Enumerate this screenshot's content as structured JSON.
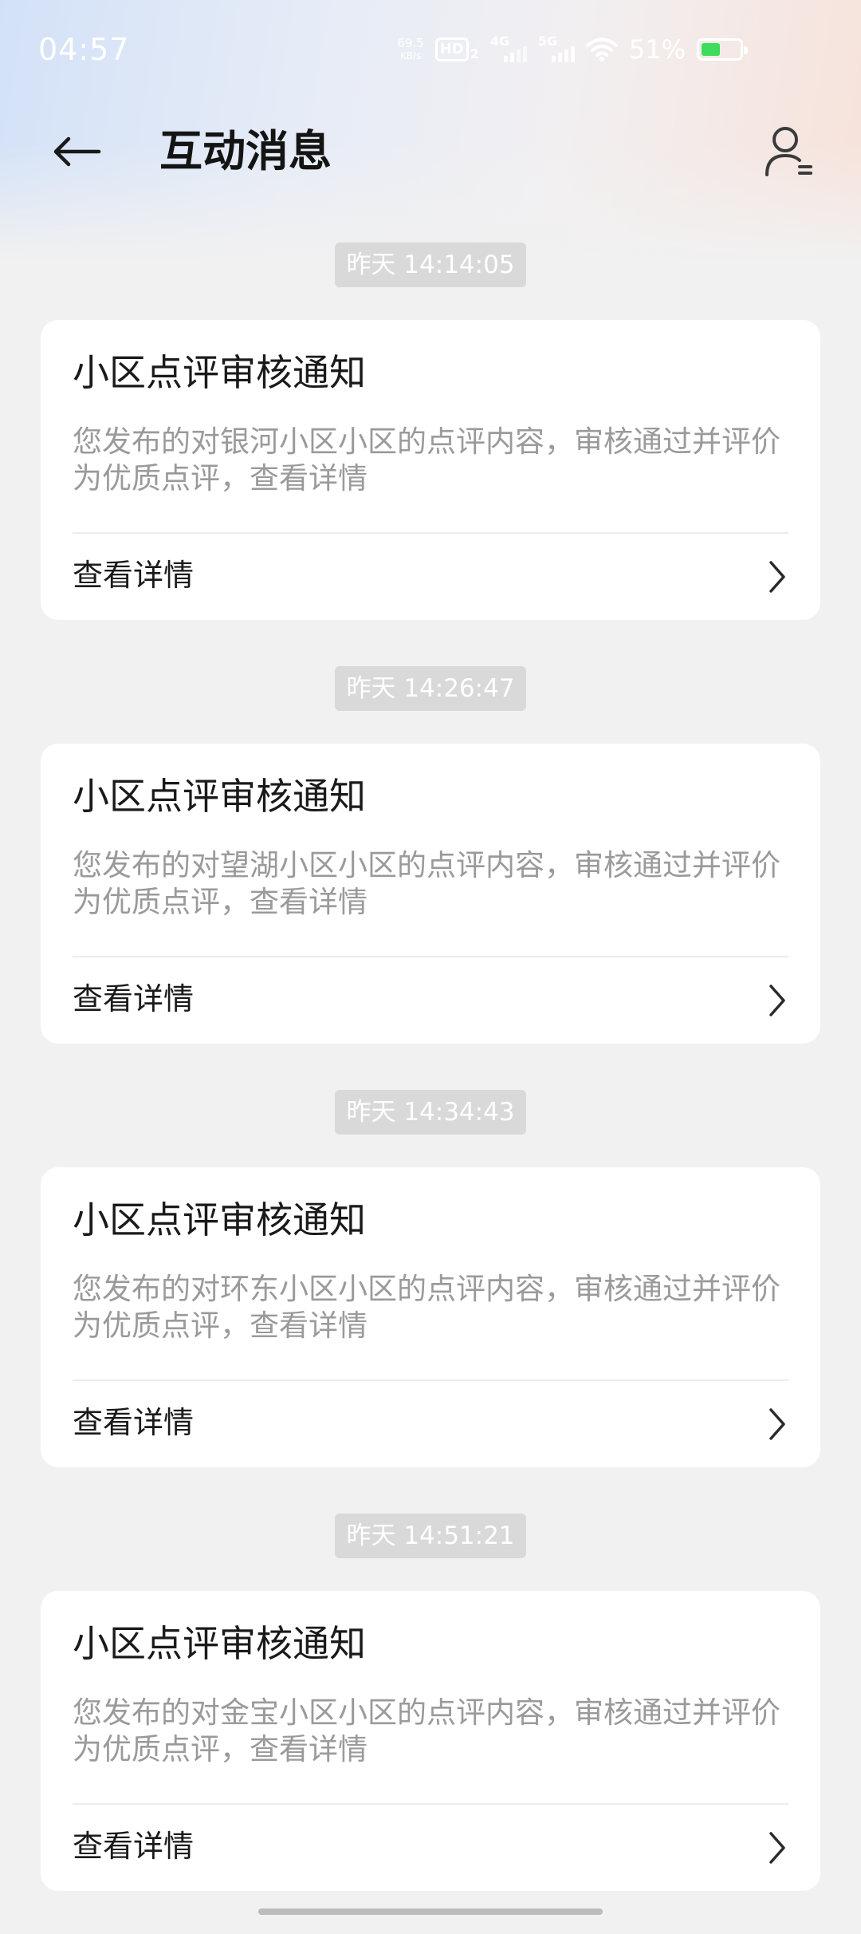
{
  "status_bar": {
    "time": "04:57",
    "net_speed_value": "69.5",
    "net_speed_unit": "KB/s",
    "hd_label": "HD",
    "hd_sub": "2",
    "net1": "4G",
    "net2": "5G",
    "battery_percent": "51%",
    "battery_level": 0.51,
    "battery_color": "#3ddc5a"
  },
  "header": {
    "title": "互动消息",
    "back_icon": "arrow-left-icon",
    "profile_icon": "user-settings-icon"
  },
  "messages": [
    {
      "time": "昨天 14:14:05",
      "title": "小区点评审核通知",
      "body": "您发布的对银河小区小区的点评内容，审核通过并评价为优质点评，查看详情",
      "action": "查看详情"
    },
    {
      "time": "昨天 14:26:47",
      "title": "小区点评审核通知",
      "body": "您发布的对望湖小区小区的点评内容，审核通过并评价为优质点评，查看详情",
      "action": "查看详情"
    },
    {
      "time": "昨天 14:34:43",
      "title": "小区点评审核通知",
      "body": "您发布的对环东小区小区的点评内容，审核通过并评价为优质点评，查看详情",
      "action": "查看详情"
    },
    {
      "time": "昨天 14:51:21",
      "title": "小区点评审核通知",
      "body": "您发布的对金宝小区小区的点评内容，审核通过并评价为优质点评，查看详情",
      "action": "查看详情"
    }
  ],
  "colors": {
    "background": "#f1f1f1",
    "card": "#ffffff",
    "timestamp_bg": "#d9d9d9",
    "secondary_text": "#9a9a9a"
  }
}
